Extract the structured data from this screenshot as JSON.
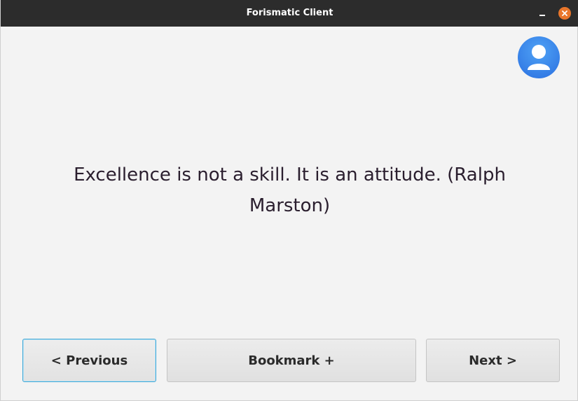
{
  "window": {
    "title": "Forismatic Client"
  },
  "titlebar_buttons": {
    "minimize_icon": "minimize-icon",
    "close_icon": "close-icon",
    "close_color": "#e9762b"
  },
  "avatar": {
    "icon": "user-icon",
    "color": "#2a6fe0"
  },
  "quote": {
    "text": "Excellence is not a skill. It is an attitude.  (Ralph Marston)"
  },
  "buttons": {
    "previous": "< Previous",
    "bookmark": "Bookmark +",
    "next": "Next >"
  },
  "colors": {
    "titlebar": "#2c2c2c",
    "background": "#f3f3f3",
    "focus_border": "#3fa7d6"
  }
}
